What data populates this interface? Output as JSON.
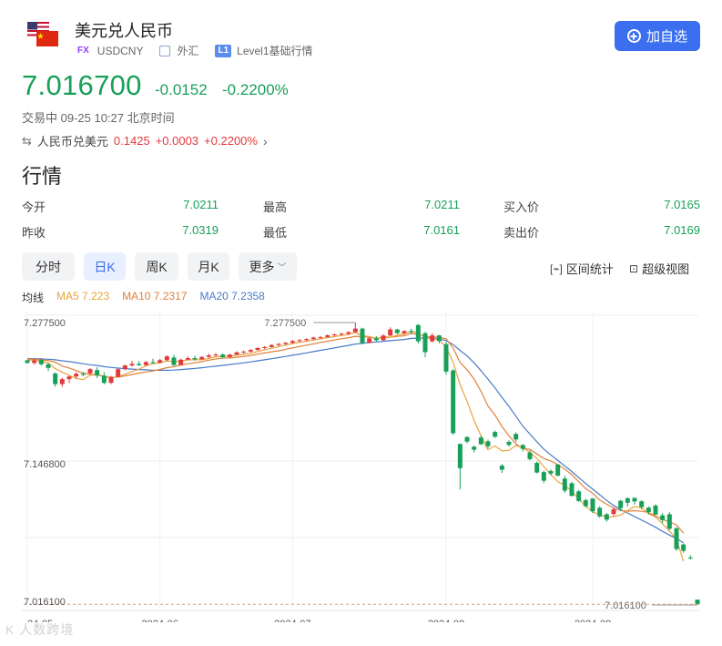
{
  "header": {
    "title": "美元兑人民币",
    "fx_tag": "FX",
    "symbol": "USDCNY",
    "market_label": "外汇",
    "level_tag": "L1",
    "level_label": "Level1基础行情",
    "add_button_label": "加自选"
  },
  "quote": {
    "price": "7.016700",
    "change": "-0.0152",
    "change_pct": "-0.2200%",
    "status": "交易中 09-25 10:27 北京时间",
    "cross_label": "人民币兑美元",
    "cross_price": "0.1425",
    "cross_change": "+0.0003",
    "cross_change_pct": "+0.2200%"
  },
  "section_title": "行情",
  "stats": {
    "open": {
      "label": "今开",
      "value": "7.0211"
    },
    "high": {
      "label": "最高",
      "value": "7.0211"
    },
    "bid": {
      "label": "买入价",
      "value": "7.0165"
    },
    "prev_close": {
      "label": "昨收",
      "value": "7.0319"
    },
    "low": {
      "label": "最低",
      "value": "7.0161"
    },
    "ask": {
      "label": "卖出价",
      "value": "7.0169"
    }
  },
  "tabs": [
    {
      "label": "分时"
    },
    {
      "label": "日K"
    },
    {
      "label": "周K"
    },
    {
      "label": "月K"
    },
    {
      "label": "更多"
    }
  ],
  "tools": {
    "interval_stats": "区间统计",
    "super_view": "超级视图"
  },
  "ma": {
    "title": "均线",
    "ma5": "MA5 7.223",
    "ma10": "MA10 7.2317",
    "ma20": "MA20 7.2358"
  },
  "colors": {
    "up": "#e4393c",
    "down": "#18a058",
    "ma5": "#e8a33d",
    "ma10": "#e0803b",
    "ma20": "#4a7bc8",
    "accent": "#3b6ff0"
  },
  "watermark": "K 人数跨境",
  "chart_data": {
    "type": "candlestick",
    "y_ticks": [
      "7.277500",
      "7.146800",
      "7.016100"
    ],
    "ylim": [
      7.0161,
      7.2775
    ],
    "x_labels": [
      "24-05",
      "2024-06",
      "2024-07",
      "2024-08",
      "2024-09"
    ],
    "x_label_index": [
      0,
      19,
      38,
      60,
      81
    ],
    "high_label": "7.277500",
    "high_value": 7.2775,
    "low_label": "7.016100",
    "low_value": 7.0161,
    "last_price": 7.0167,
    "candles": [
      [
        7.2425,
        7.2429,
        7.2394,
        7.2401
      ],
      [
        7.2401,
        7.2441,
        7.2388,
        7.2424
      ],
      [
        7.2429,
        7.2446,
        7.2376,
        7.2389
      ],
      [
        7.2389,
        7.2396,
        7.2327,
        7.2355
      ],
      [
        7.2304,
        7.2313,
        7.2182,
        7.2205
      ],
      [
        7.2205,
        7.2264,
        7.2181,
        7.2251
      ],
      [
        7.2251,
        7.2283,
        7.2215,
        7.2276
      ],
      [
        7.2276,
        7.2316,
        7.2256,
        7.2301
      ],
      [
        7.2301,
        7.2317,
        7.2277,
        7.2291
      ],
      [
        7.2305,
        7.2353,
        7.2292,
        7.2344
      ],
      [
        7.2335,
        7.2362,
        7.2262,
        7.2284
      ],
      [
        7.2284,
        7.2317,
        7.2202,
        7.2217
      ],
      [
        7.2217,
        7.2282,
        7.2205,
        7.2272
      ],
      [
        7.2272,
        7.2351,
        7.2268,
        7.2343
      ],
      [
        7.2343,
        7.2385,
        7.2335,
        7.2378
      ],
      [
        7.2378,
        7.2423,
        7.2367,
        7.2393
      ],
      [
        7.2393,
        7.2418,
        7.2374,
        7.2381
      ],
      [
        7.2381,
        7.2421,
        7.2378,
        7.2409
      ],
      [
        7.2409,
        7.2441,
        7.2395,
        7.2403
      ],
      [
        7.2403,
        7.2438,
        7.2397,
        7.2427
      ],
      [
        7.2427,
        7.2473,
        7.2418,
        7.2462
      ],
      [
        7.2451,
        7.2476,
        7.2376,
        7.2382
      ],
      [
        7.2382,
        7.2441,
        7.2378,
        7.2431
      ],
      [
        7.2431,
        7.2462,
        7.2427,
        7.2446
      ],
      [
        7.2446,
        7.2467,
        7.2423,
        7.2435
      ],
      [
        7.2435,
        7.2463,
        7.2428,
        7.2457
      ],
      [
        7.2457,
        7.2488,
        7.2448,
        7.2472
      ],
      [
        7.2472,
        7.2493,
        7.2461,
        7.2479
      ],
      [
        7.2479,
        7.2491,
        7.2448,
        7.2455
      ],
      [
        7.2455,
        7.2486,
        7.2445,
        7.2478
      ],
      [
        7.2478,
        7.2508,
        7.2472,
        7.2499
      ],
      [
        7.2499,
        7.2515,
        7.2486,
        7.2506
      ],
      [
        7.2506,
        7.2531,
        7.2497,
        7.2521
      ],
      [
        7.2521,
        7.2548,
        7.2515,
        7.2539
      ],
      [
        7.2539,
        7.2557,
        7.2529,
        7.2548
      ],
      [
        7.2548,
        7.2576,
        7.2541,
        7.2567
      ],
      [
        7.2567,
        7.2586,
        7.2555,
        7.2577
      ],
      [
        7.2577,
        7.2595,
        7.2566,
        7.2588
      ],
      [
        7.2588,
        7.2613,
        7.2579,
        7.2604
      ],
      [
        7.2604,
        7.2621,
        7.2592,
        7.2612
      ],
      [
        7.2612,
        7.2631,
        7.2602,
        7.2622
      ],
      [
        7.2622,
        7.2645,
        7.2612,
        7.2636
      ],
      [
        7.2636,
        7.2651,
        7.2624,
        7.2641
      ],
      [
        7.2641,
        7.2665,
        7.2633,
        7.2657
      ],
      [
        7.2657,
        7.2673,
        7.2645,
        7.2665
      ],
      [
        7.2665,
        7.2681,
        7.2652,
        7.2672
      ],
      [
        7.2672,
        7.2695,
        7.2661,
        7.2686
      ],
      [
        7.2686,
        7.2775,
        7.2681,
        7.2719
      ],
      [
        7.2719,
        7.2728,
        7.2573,
        7.2586
      ],
      [
        7.2586,
        7.2641,
        7.2583,
        7.2629
      ],
      [
        7.2629,
        7.2649,
        7.2599,
        7.2611
      ],
      [
        7.2611,
        7.2666,
        7.2604,
        7.2655
      ],
      [
        7.2655,
        7.2731,
        7.2648,
        7.2711
      ],
      [
        7.2711,
        7.2718,
        7.2665,
        7.2677
      ],
      [
        7.2677,
        7.2704,
        7.2662,
        7.2696
      ],
      [
        7.2696,
        7.2718,
        7.2666,
        7.2686
      ],
      [
        7.2752,
        7.2763,
        7.2581,
        7.2601
      ],
      [
        7.2676,
        7.2689,
        7.2453,
        7.2501
      ],
      [
        7.2601,
        7.2677,
        7.2591,
        7.2656
      ],
      [
        7.2656,
        7.2661,
        7.2582,
        7.2604
      ],
      [
        7.2575,
        7.2598,
        7.2293,
        7.2321
      ],
      [
        7.2331,
        7.2345,
        7.1736,
        7.1751
      ],
      [
        7.1651,
        7.1656,
        7.1231,
        7.1427
      ],
      [
        7.1715,
        7.1723,
        7.1658,
        7.1673
      ],
      [
        7.1626,
        7.1636,
        7.1571,
        7.1598
      ],
      [
        7.1711,
        7.1731,
        7.1641,
        7.1649
      ],
      [
        7.1676,
        7.1691,
        7.1613,
        7.1631
      ],
      [
        7.1762,
        7.1776,
        7.1707,
        7.1718
      ],
      [
        7.1451,
        7.1466,
        7.1384,
        7.1413
      ],
      [
        7.1671,
        7.1685,
        7.1626,
        7.1643
      ],
      [
        7.1744,
        7.1758,
        7.1669,
        7.1693
      ],
      [
        7.1641,
        7.1651,
        7.1582,
        7.1606
      ],
      [
        7.1572,
        7.1593,
        7.1497,
        7.1511
      ],
      [
        7.1476,
        7.1489,
        7.1378,
        7.1387
      ],
      [
        7.1391,
        7.1406,
        7.1289,
        7.1311
      ],
      [
        7.1401,
        7.1416,
        7.1358,
        7.1377
      ],
      [
        7.1461,
        7.1466,
        7.1351,
        7.1358
      ],
      [
        7.1331,
        7.1359,
        7.1198,
        7.1219
      ],
      [
        7.1288,
        7.1301,
        7.1164,
        7.1171
      ],
      [
        7.1213,
        7.1226,
        7.1117,
        7.1123
      ],
      [
        7.1131,
        7.1146,
        7.1064,
        7.1076
      ],
      [
        7.1146,
        7.1151,
        7.1009,
        7.1028
      ],
      [
        7.1061,
        7.1076,
        7.0969,
        7.0981
      ],
      [
        7.1001,
        7.1011,
        7.0932,
        7.0951
      ],
      [
        7.1003,
        7.1059,
        7.0981,
        7.1047
      ],
      [
        7.1126,
        7.1133,
        7.1031,
        7.1058
      ],
      [
        7.1149,
        7.1158,
        7.1072,
        7.1107
      ],
      [
        7.1151,
        7.1159,
        7.1091,
        7.1119
      ],
      [
        7.1121,
        7.1131,
        7.1047,
        7.1067
      ],
      [
        7.1062,
        7.1074,
        7.0999,
        7.1021
      ],
      [
        7.1081,
        7.1093,
        7.0991,
        7.0998
      ],
      [
        7.0991,
        7.1011,
        7.0921,
        7.0946
      ],
      [
        7.1001,
        7.1021,
        7.0851,
        7.0867
      ],
      [
        7.0871,
        7.0881,
        7.0661,
        7.0679
      ],
      [
        7.0721,
        7.0731,
        7.0644,
        7.0662
      ],
      [
        7.0601,
        7.0621,
        7.0581,
        7.0593
      ],
      [
        7.0211,
        7.0211,
        7.0161,
        7.0167
      ]
    ],
    "ma5": [
      7.2431,
      7.2424,
      7.2415,
      7.2403,
      7.2348,
      7.2317,
      7.2286,
      7.2258,
      7.2247,
      7.2288,
      7.2292,
      7.2273,
      7.2263,
      7.2275,
      7.2297,
      7.2321,
      7.2343,
      7.2374,
      7.2395,
      7.2403,
      7.2419,
      7.2414,
      7.2419,
      7.2429,
      7.2431,
      7.2431,
      7.2442,
      7.2459,
      7.2461,
      7.2464,
      7.2473,
      7.2481,
      7.2491,
      7.2507,
      7.2523,
      7.2536,
      7.2552,
      7.2566,
      7.2581,
      7.2592,
      7.2602,
      7.2613,
      7.2624,
      7.2635,
      7.2644,
      7.2655,
      7.2664,
      7.2683,
      7.2653,
      7.2645,
      7.2626,
      7.2644,
      7.2639,
      7.2657,
      7.2672,
      7.2695,
      7.2677,
      7.2635,
      7.2628,
      7.2616,
      7.2549,
      7.2408,
      7.2202,
      7.2047,
      7.1868,
      7.1727,
      7.1598,
      7.1633,
      7.1587,
      7.1592,
      7.1637,
      7.1618,
      7.1571,
      7.1519,
      7.1441,
      7.1371,
      7.1301,
      7.1268,
      7.1215,
      7.1141,
      7.1076,
      7.1022,
      7.0996,
      7.0973,
      7.0978,
      7.0994,
      7.1036,
      7.1072,
      7.1061,
      7.1007,
      7.0975,
      7.0913,
      7.0845,
      7.0771,
      7.0566
    ],
    "ma10": [
      7.2437,
      7.2434,
      7.2429,
      7.2423,
      7.2408,
      7.2372,
      7.2354,
      7.2331,
      7.2306,
      7.2296,
      7.2293,
      7.2279,
      7.2266,
      7.2271,
      7.2282,
      7.2294,
      7.2307,
      7.2318,
      7.2327,
      7.2341,
      7.2358,
      7.2367,
      7.2381,
      7.2394,
      7.2402,
      7.2413,
      7.2427,
      7.2438,
      7.2446,
      7.2447,
      7.2454,
      7.2461,
      7.2471,
      7.2482,
      7.2493,
      7.2504,
      7.2514,
      7.2527,
      7.2541,
      7.2553,
      7.2566,
      7.2578,
      7.2591,
      7.2602,
      7.2613,
      7.2625,
      7.2635,
      7.2648,
      7.2644,
      7.2639,
      7.2631,
      7.2634,
      7.2639,
      7.2647,
      7.2653,
      7.2675,
      7.2665,
      7.2645,
      7.2641,
      7.264,
      7.2624,
      7.254,
      7.2406,
      7.2337,
      7.2252,
      7.2138,
      7.2003,
      7.1918,
      7.1814,
      7.1727,
      7.1651,
      7.1608,
      7.1602,
      7.1558,
      7.1517,
      7.1494,
      7.146,
      7.1419,
      7.1367,
      7.1302,
      7.1238,
      7.1196,
      7.1132,
      7.1094,
      7.106,
      7.1035,
      7.1029,
      7.1034,
      7.1028,
      7.1018,
      7.0985,
      7.0954,
      7.0928,
      7.0902,
      7.0826
    ],
    "ma20": [
      7.2441,
      7.244,
      7.2438,
      7.2435,
      7.243,
      7.2421,
      7.2413,
      7.2404,
      7.2394,
      7.2385,
      7.2378,
      7.2367,
      7.2359,
      7.2353,
      7.2348,
      7.2344,
      7.234,
      7.2337,
      7.2334,
      7.2333,
      7.2333,
      7.2335,
      7.234,
      7.2345,
      7.235,
      7.2357,
      7.2364,
      7.2371,
      7.2379,
      7.2386,
      7.2394,
      7.2402,
      7.2411,
      7.2421,
      7.243,
      7.244,
      7.245,
      7.2461,
      7.2472,
      7.2483,
      7.2494,
      7.2506,
      7.2518,
      7.2529,
      7.254,
      7.2552,
      7.2563,
      7.2576,
      7.2583,
      7.259,
      7.2595,
      7.2601,
      7.2607,
      7.2612,
      7.2618,
      7.2628,
      7.2631,
      7.2631,
      7.263,
      7.2623,
      7.2608,
      7.2571,
      7.2517,
      7.2466,
      7.2402,
      7.233,
      7.2251,
      7.217,
      7.2083,
      7.1999,
      7.1908,
      7.1815,
      7.1743,
      7.1671,
      7.1604,
      7.155,
      7.1498,
      7.1449,
      7.1396,
      7.134,
      7.1285,
      7.1233,
      7.1181,
      7.1129,
      7.1083,
      7.1045,
      7.1012,
      7.098,
      7.0947,
      7.0915,
      7.088,
      7.0842,
      7.0808,
      7.0777,
      7.0737
    ]
  }
}
